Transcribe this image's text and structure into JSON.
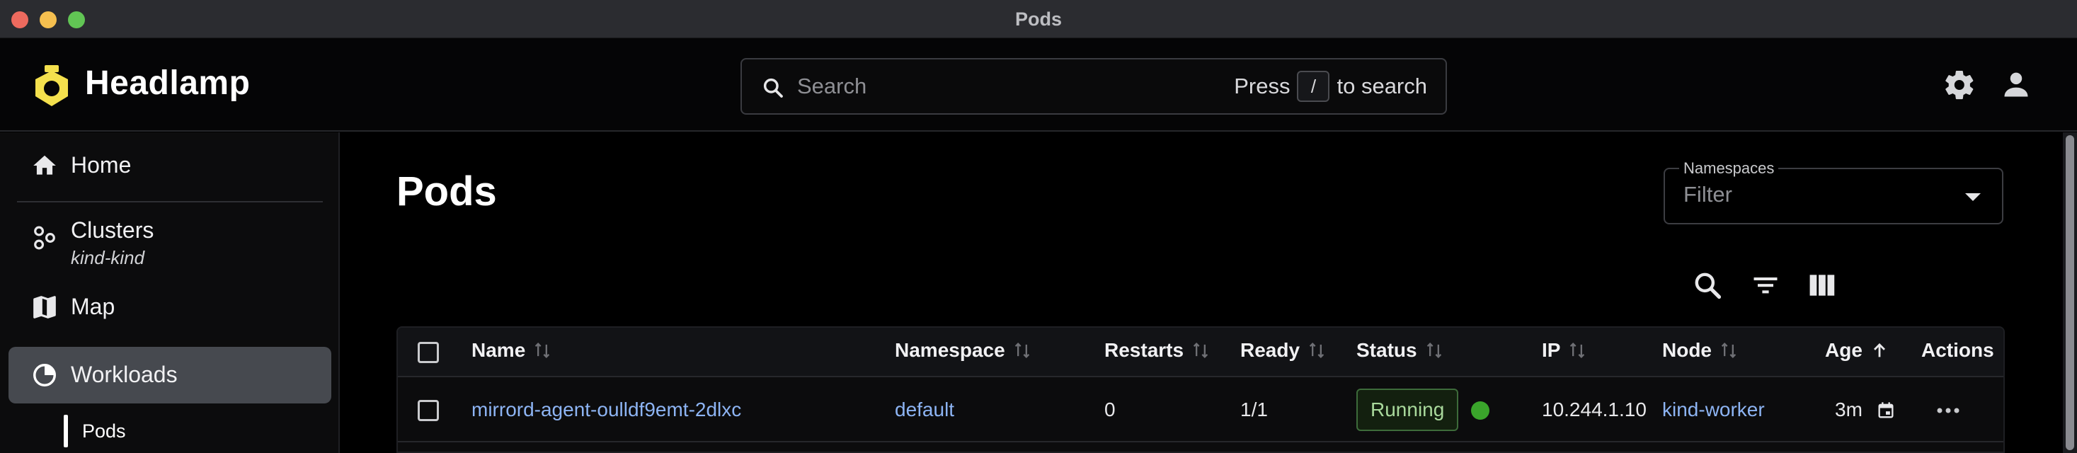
{
  "window": {
    "title": "Pods"
  },
  "app": {
    "name": "Headlamp"
  },
  "search": {
    "placeholder": "Search",
    "hint_prefix": "Press",
    "hint_key": "/",
    "hint_suffix": "to search"
  },
  "sidebar": {
    "items": [
      {
        "label": "Home",
        "icon": "home-icon"
      },
      {
        "label": "Clusters",
        "sublabel": "kind-kind",
        "icon": "clusters-icon"
      },
      {
        "label": "Map",
        "icon": "map-icon"
      },
      {
        "label": "Workloads",
        "icon": "workloads-icon",
        "active": true
      }
    ],
    "subitems": [
      {
        "label": "Pods",
        "active": true
      }
    ]
  },
  "main": {
    "title": "Pods",
    "namespaces": {
      "legend": "Namespaces",
      "placeholder": "Filter"
    }
  },
  "table": {
    "columns": [
      "Name",
      "Namespace",
      "Restarts",
      "Ready",
      "Status",
      "IP",
      "Node",
      "Age",
      "Actions"
    ],
    "rows": [
      {
        "name": "mirrord-agent-oulldf9emt-2dlxc",
        "namespace": "default",
        "restarts": "0",
        "ready": "1/1",
        "status": "Running",
        "ip": "10.244.1.10",
        "node": "kind-worker",
        "age": "3m"
      }
    ]
  },
  "colors": {
    "accent_logo": "#f4e04d",
    "link": "#8db4f3",
    "status_running": "#3aa52b",
    "sidebar_active": "#46494f"
  }
}
